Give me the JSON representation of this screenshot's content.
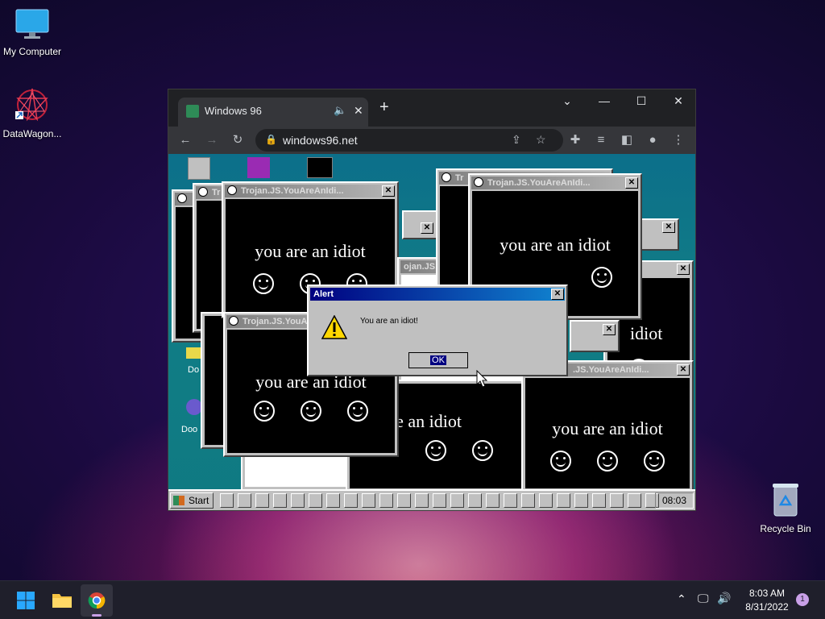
{
  "desktop": {
    "icons": [
      {
        "label": "My Computer",
        "icon": "monitor-icon"
      },
      {
        "label": "DataWagon...",
        "icon": "datawagon-icon"
      },
      {
        "label": "Recycle Bin",
        "icon": "recycle-bin-icon"
      }
    ]
  },
  "browser": {
    "tab_title": "Windows 96",
    "url": "windows96.net",
    "tab_audio_icon": "speaker-icon",
    "new_tab_glyph": "+"
  },
  "win96": {
    "desktop_icons": [
      {
        "label": "Do"
      },
      {
        "label": "Doo"
      }
    ],
    "popup_title": "Trojan.JS.YouAreAnIdi...",
    "popup_title_short": "Tr",
    "popup_message": "you are an idiot",
    "popup_fragment": "are an idiot",
    "popup_fragment2": "idiot",
    "popup_fragment3": "ojan.JS.YouAreAnIdi...",
    "popup_fragment4": ".JS.YouAreAnIdi...",
    "alert": {
      "title": "Alert",
      "message": "You are an idiot!",
      "ok_label": "OK"
    },
    "start_label": "Start",
    "clock": "08:03"
  },
  "taskbar": {
    "time": "8:03 AM",
    "date": "8/31/2022",
    "notification_count": "1"
  },
  "colors": {
    "alert_title": "#000080",
    "chrome_bg": "#202124",
    "win96_teal": "#117d86"
  }
}
